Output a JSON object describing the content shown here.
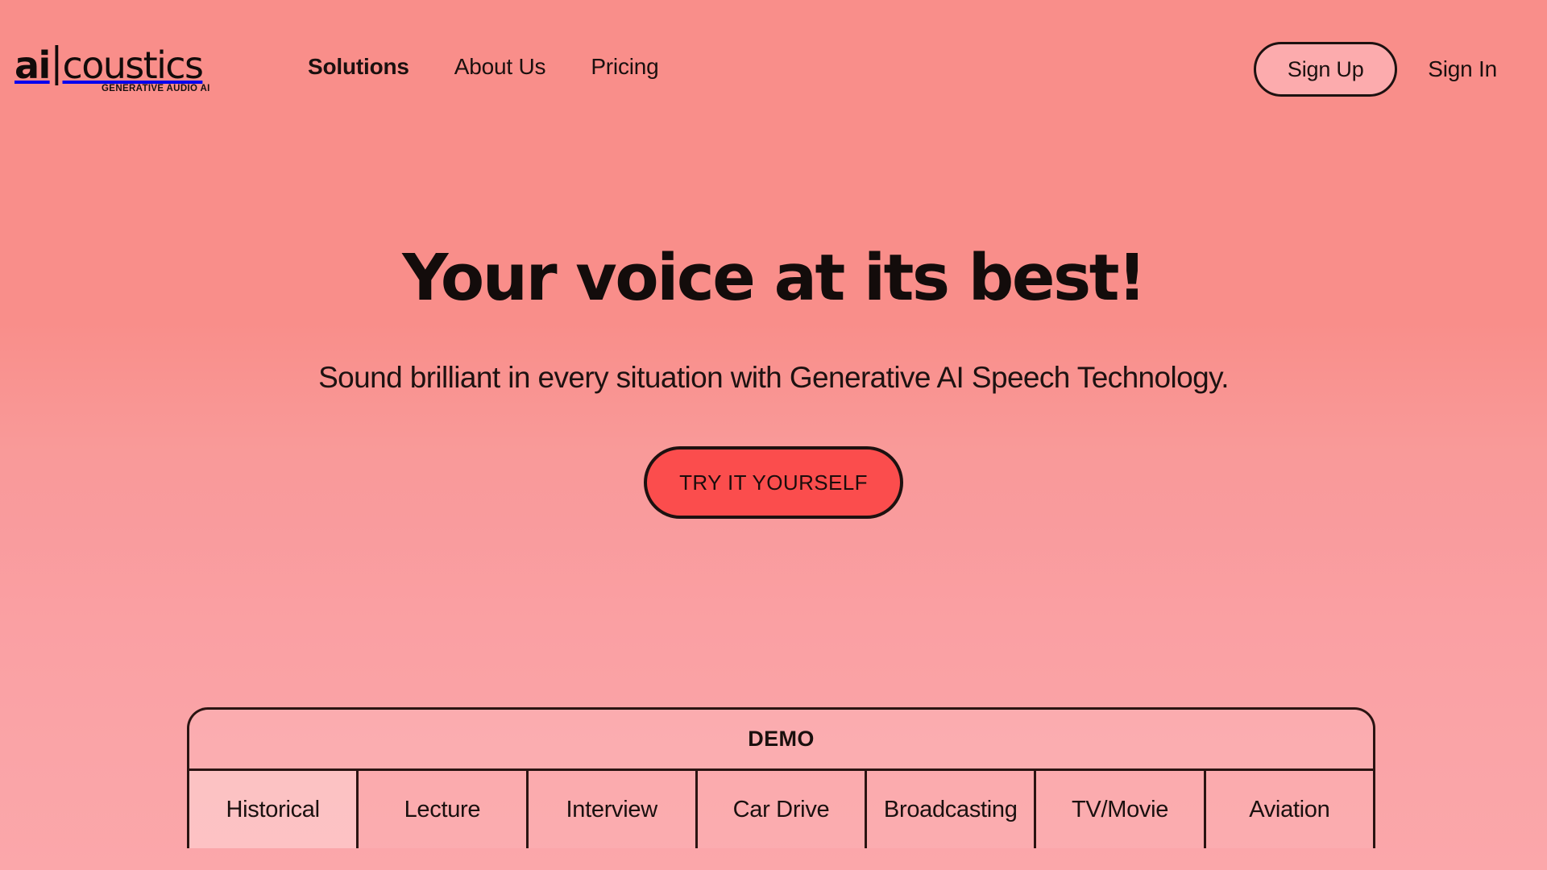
{
  "header": {
    "logo": {
      "ai": "ai",
      "bar": "|",
      "rest": "coustics",
      "tagline": "GENERATIVE AUDIO AI"
    },
    "nav": [
      {
        "label": "Solutions",
        "active": true
      },
      {
        "label": "About Us",
        "active": false
      },
      {
        "label": "Pricing",
        "active": false
      }
    ],
    "auth": {
      "sign_up_label": "Sign Up",
      "sign_in_label": "Sign In"
    }
  },
  "hero": {
    "title": "Your voice at its best!",
    "subtitle": "Sound brilliant in every situation with Generative AI Speech Technology.",
    "cta_label": "TRY IT YOURSELF"
  },
  "demo": {
    "header_label": "DEMO",
    "tabs": [
      {
        "label": "Historical",
        "active": true
      },
      {
        "label": "Lecture",
        "active": false
      },
      {
        "label": "Interview",
        "active": false
      },
      {
        "label": "Car Drive",
        "active": false
      },
      {
        "label": "Broadcasting",
        "active": false
      },
      {
        "label": "TV/Movie",
        "active": false
      },
      {
        "label": "Aviation",
        "active": false
      }
    ]
  },
  "colors": {
    "background_top": "#f98e8a",
    "background_bottom": "#fba7aa",
    "ink": "#1c1210",
    "cta_red": "#fb4d4d",
    "signup_fill": "#fcabad",
    "border": "#2a1412"
  }
}
